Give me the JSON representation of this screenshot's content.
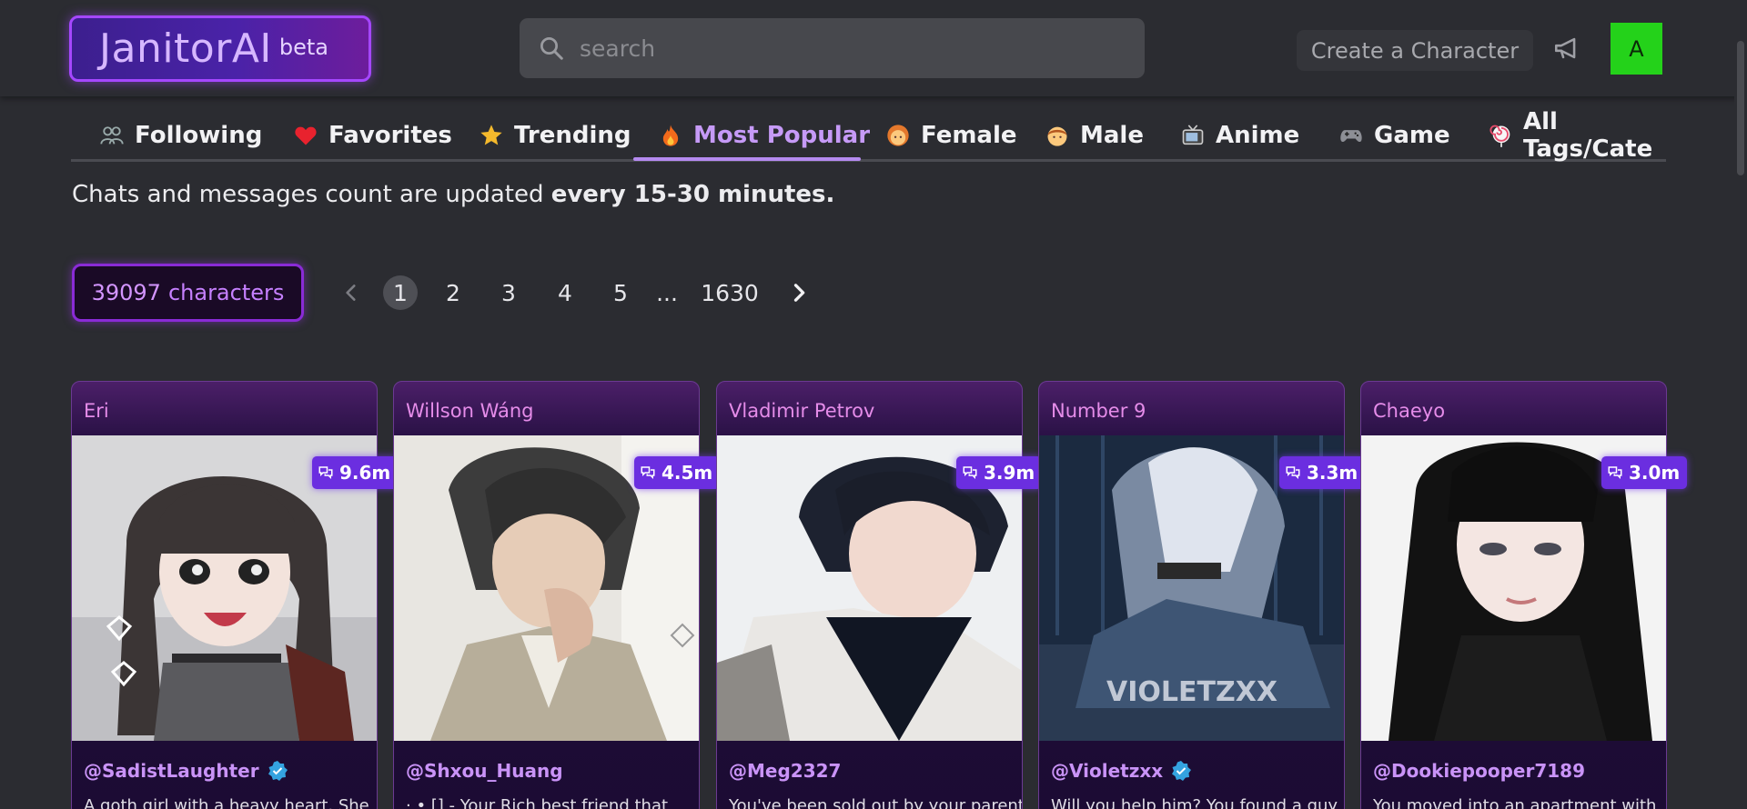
{
  "header": {
    "logo_text": "JanitorAI",
    "logo_badge": "beta",
    "search_placeholder": "search",
    "create_label": "Create a Character",
    "avatar_letter": "A",
    "colors": {
      "brand": "#a547ff",
      "avatar_bg": "#24d21a",
      "accent": "#c69af7"
    }
  },
  "tabs": [
    {
      "label": "Following",
      "icon": "users-icon"
    },
    {
      "label": "Favorites",
      "icon": "heart-icon"
    },
    {
      "label": "Trending",
      "icon": "star-icon"
    },
    {
      "label": "Most Popular",
      "icon": "fire-icon",
      "active": true
    },
    {
      "label": "Female",
      "icon": "woman-face-icon"
    },
    {
      "label": "Male",
      "icon": "man-face-icon"
    },
    {
      "label": "Anime",
      "icon": "tv-icon"
    },
    {
      "label": "Game",
      "icon": "gamepad-icon"
    },
    {
      "label": "All Tags/Cate",
      "icon": "lollipop-icon"
    }
  ],
  "notice": {
    "prefix": "Chats and messages count are updated ",
    "bold": "every 15-30 minutes."
  },
  "pagination": {
    "count": "39097",
    "count_label": "characters",
    "pages": [
      "1",
      "2",
      "3",
      "4",
      "5",
      "...",
      "1630"
    ],
    "current": "1"
  },
  "cards": [
    {
      "name": "Eri",
      "chats": "9.6m",
      "author": "@SadistLaughter",
      "verified": true,
      "desc": "A goth girl with a heavy heart. She"
    },
    {
      "name": "Willson Wáng",
      "chats": "4.5m",
      "author": "@Shxou_Huang",
      "verified": false,
      "desc": "· • [] - Your Rich best friend that"
    },
    {
      "name": "Vladimir Petrov",
      "chats": "3.9m",
      "author": "@Meg2327",
      "verified": false,
      "desc": "You've been sold out by your parents"
    },
    {
      "name": "Number 9",
      "chats": "3.3m",
      "author": "@Violetzxx",
      "verified": true,
      "desc": "Will you help him? You found a guy"
    },
    {
      "name": "Chaeyo",
      "chats": "3.0m",
      "author": "@Dookiepooper7189",
      "verified": false,
      "desc": "You moved into an apartment with"
    }
  ]
}
